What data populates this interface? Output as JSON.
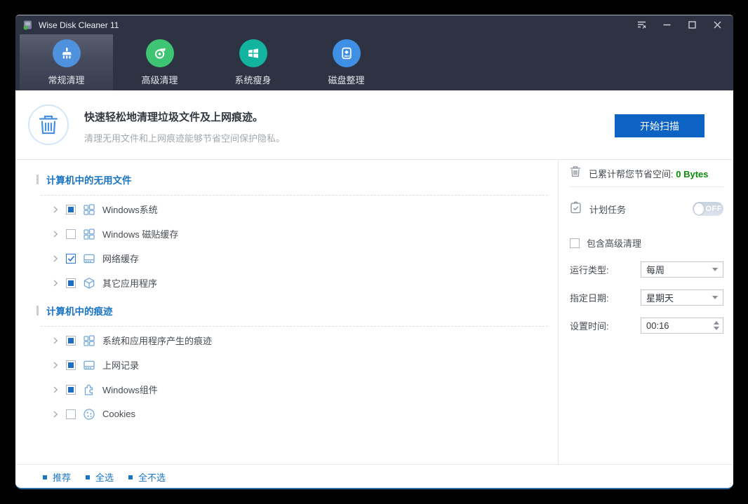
{
  "window": {
    "title": "Wise Disk Cleaner 11"
  },
  "nav": {
    "tabs": [
      {
        "label": "常规清理",
        "selected": true,
        "icon": "brush-icon",
        "color": "#4e92dd"
      },
      {
        "label": "高级清理",
        "selected": false,
        "icon": "dial-icon",
        "color": "#3ec573"
      },
      {
        "label": "系统瘦身",
        "selected": false,
        "icon": "windows-flag-icon",
        "color": "#12b4a0"
      },
      {
        "label": "磁盘整理",
        "selected": false,
        "icon": "disk-icon",
        "color": "#3f90e5"
      }
    ]
  },
  "header": {
    "title": "快速轻松地清理垃圾文件及上网痕迹。",
    "subtitle": "清理无用文件和上网痕迹能够节省空间保护隐私。",
    "scan_button": "开始扫描"
  },
  "left_panel": {
    "sections": [
      {
        "title": "计算机中的无用文件",
        "items": [
          {
            "label": "Windows系统",
            "checkbox": "partial",
            "icon": "windows-grid-icon"
          },
          {
            "label": "Windows 磁贴缓存",
            "checkbox": "unchecked",
            "icon": "windows-grid-icon"
          },
          {
            "label": "网络缓存",
            "checkbox": "checked",
            "icon": "browser-icon"
          },
          {
            "label": "其它应用程序",
            "checkbox": "partial",
            "icon": "cube-icon"
          }
        ]
      },
      {
        "title": "计算机中的痕迹",
        "items": [
          {
            "label": "系统和应用程序产生的痕迹",
            "checkbox": "partial",
            "icon": "windows-grid-icon"
          },
          {
            "label": "上网记录",
            "checkbox": "partial",
            "icon": "browser-icon"
          },
          {
            "label": "Windows组件",
            "checkbox": "partial",
            "icon": "puzzle-icon"
          },
          {
            "label": "Cookies",
            "checkbox": "unchecked",
            "icon": "cookie-icon"
          }
        ]
      }
    ]
  },
  "right_panel": {
    "savings_label": "已累计帮您节省空间:",
    "savings_value": "0 Bytes",
    "schedule_label": "计划任务",
    "schedule_toggle": "OFF",
    "include_advanced_label": "包含高级清理",
    "fields": [
      {
        "label": "运行类型:",
        "value": "每周"
      },
      {
        "label": "指定日期:",
        "value": "星期天"
      },
      {
        "label": "设置时间:",
        "value": "00:16"
      }
    ]
  },
  "footer": {
    "links": [
      "推荐",
      "全选",
      "全不选"
    ]
  },
  "colors": {
    "topband": "#2d3343",
    "accent_blue": "#0c63c4",
    "link_blue": "#1a74c4",
    "success_green": "#0b8a0b"
  }
}
